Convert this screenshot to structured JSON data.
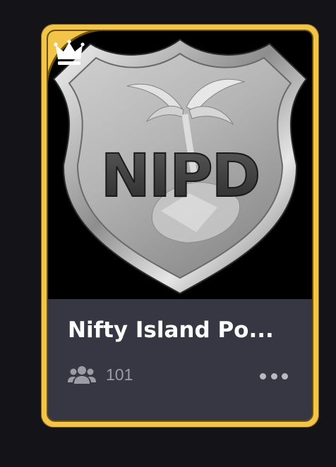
{
  "card": {
    "title": "Nifty Island Po...",
    "badge_icon": "crown-icon",
    "image_text": "NIPD",
    "members_icon": "users-icon",
    "member_count": "101",
    "more_icon": "more-horizontal-icon",
    "colors": {
      "frame": "#f2c44a",
      "footer": "#373743",
      "title": "#ffffff",
      "meta": "#9c9ca6"
    }
  }
}
